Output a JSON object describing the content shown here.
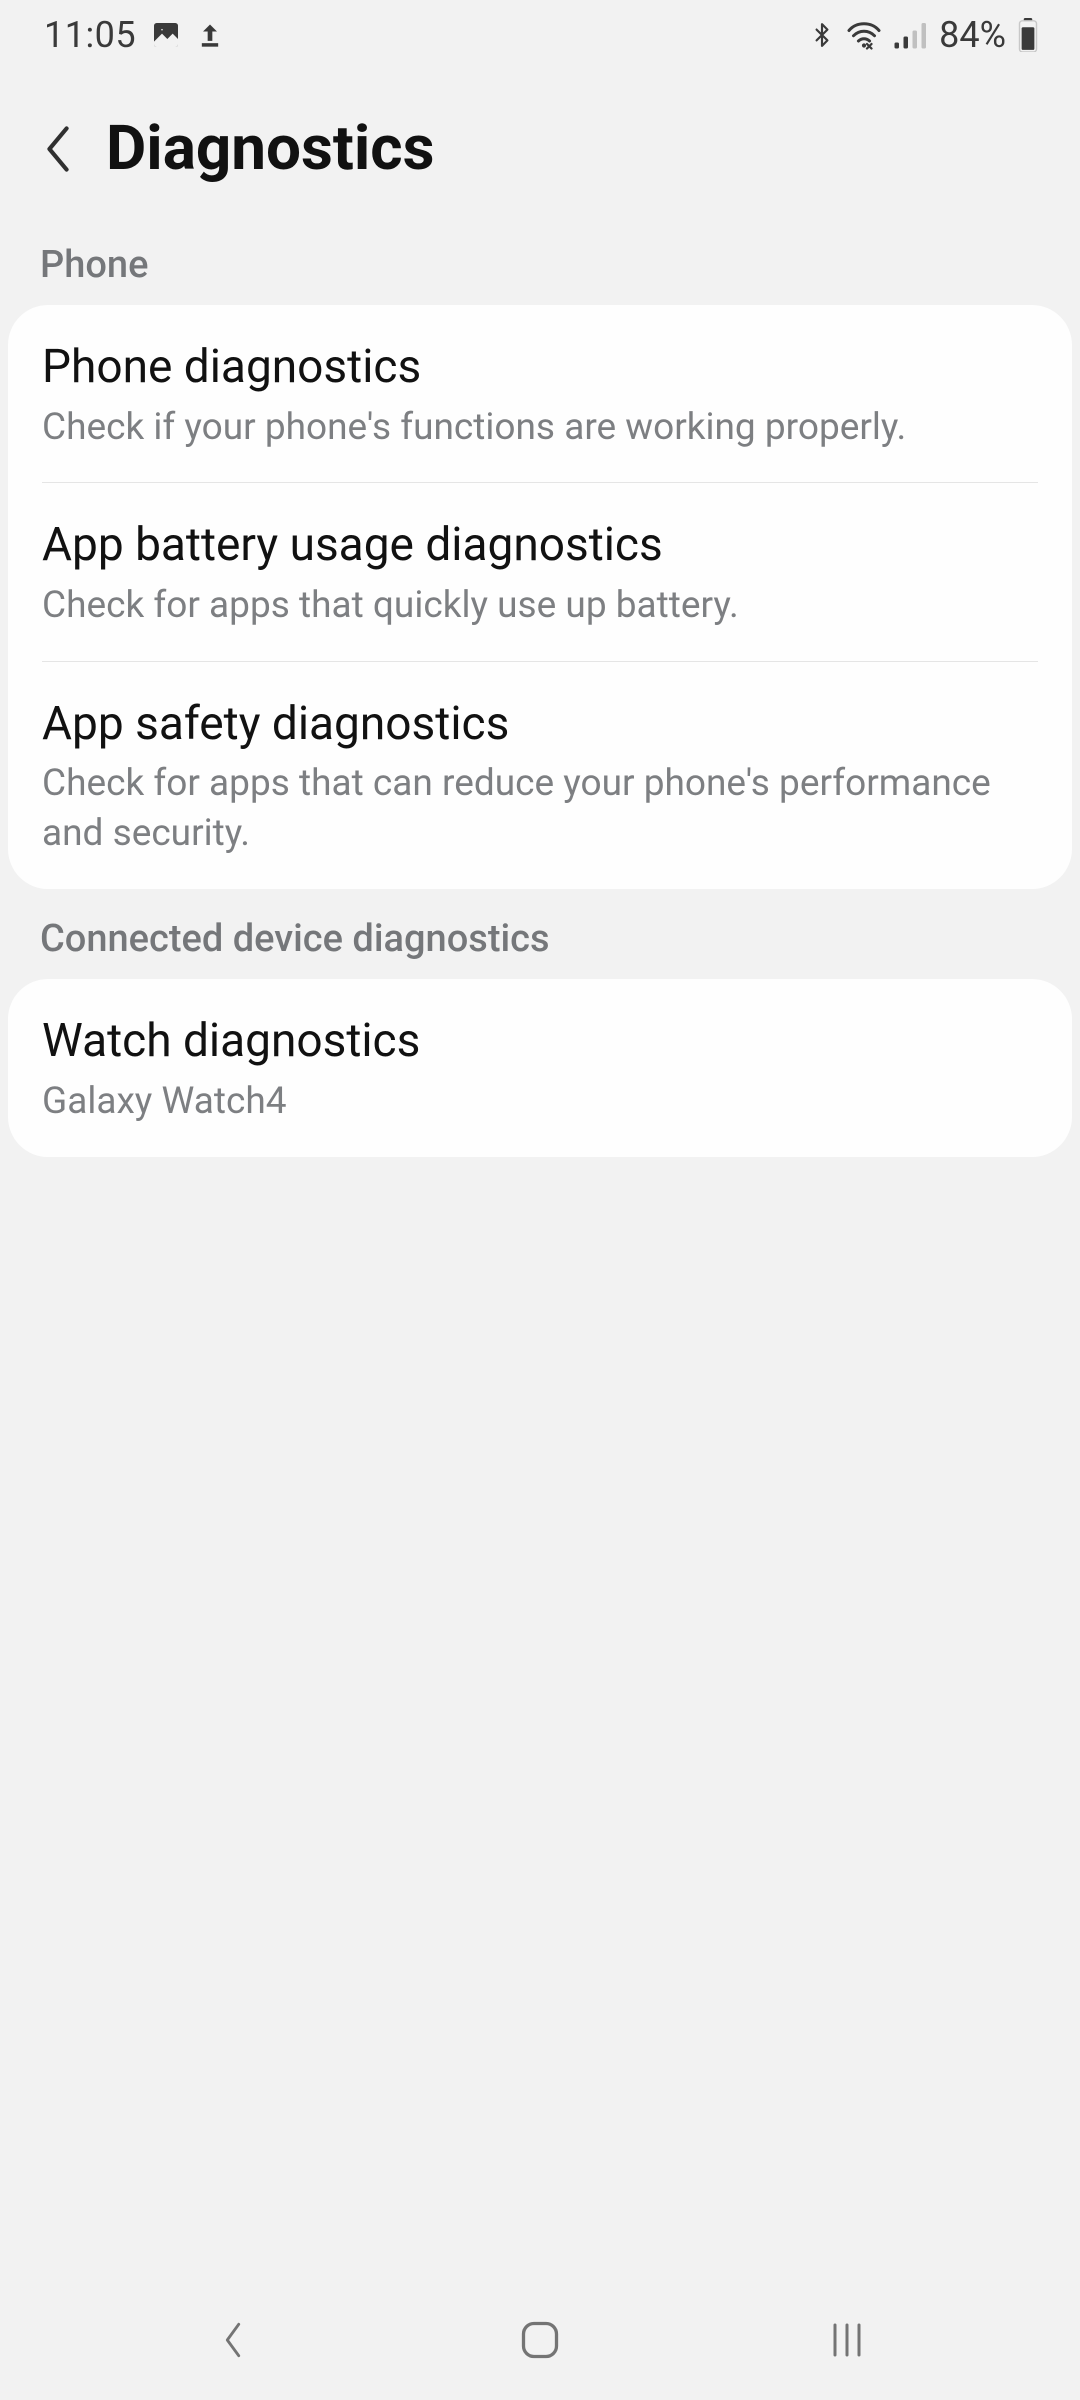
{
  "status": {
    "time": "11:05",
    "battery": "84%"
  },
  "header": {
    "title": "Diagnostics"
  },
  "sections": {
    "phone": {
      "label": "Phone",
      "items": [
        {
          "title": "Phone diagnostics",
          "sub": "Check if your phone's functions are working properly."
        },
        {
          "title": "App battery usage diagnostics",
          "sub": "Check for apps that quickly use up battery."
        },
        {
          "title": "App safety diagnostics",
          "sub": "Check for apps that can reduce your phone's performance and security."
        }
      ]
    },
    "connected": {
      "label": "Connected device diagnostics",
      "items": [
        {
          "title": "Watch diagnostics",
          "sub": "Galaxy Watch4"
        }
      ]
    }
  }
}
